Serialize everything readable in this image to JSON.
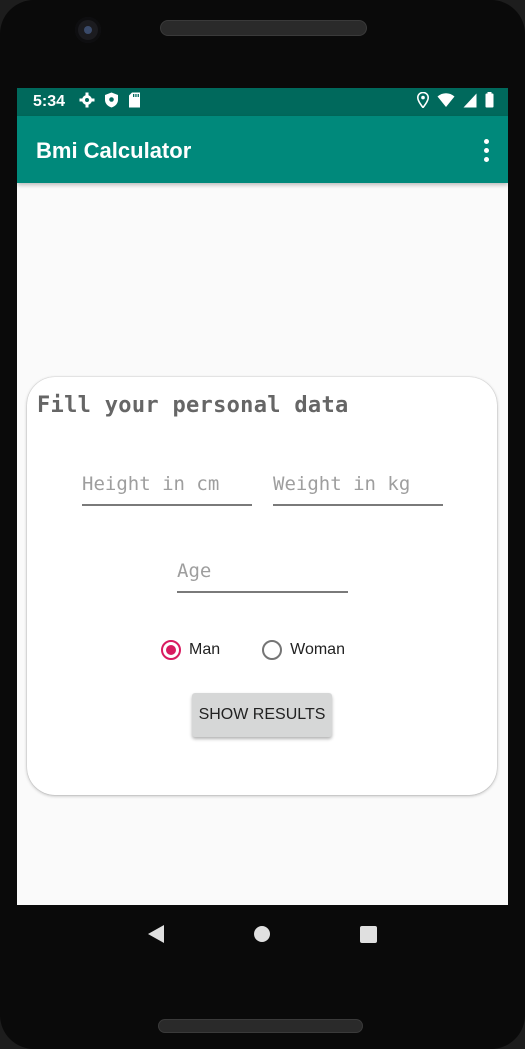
{
  "status_bar": {
    "time": "5:34",
    "left_icons": [
      "gear-icon",
      "shield-icon",
      "sd-card-icon"
    ],
    "right_icons": [
      "location-icon",
      "wifi-icon",
      "signal-icon",
      "battery-icon"
    ]
  },
  "app_bar": {
    "title": "Bmi Calculator",
    "menu_icon": "more-vert-icon"
  },
  "card": {
    "title": "Fill your personal data",
    "height_placeholder": "Height in cm",
    "weight_placeholder": "Weight in kg",
    "age_placeholder": "Age",
    "gender_options": [
      "Man",
      "Woman"
    ],
    "selected_gender": "Man",
    "button_label": "SHOW RESULTS"
  },
  "colors": {
    "status_bar": "#00695c",
    "app_bar": "#00897b",
    "accent": "#d81b60"
  },
  "nav_bar": {
    "icons": [
      "back-icon",
      "home-icon",
      "recents-icon"
    ]
  }
}
